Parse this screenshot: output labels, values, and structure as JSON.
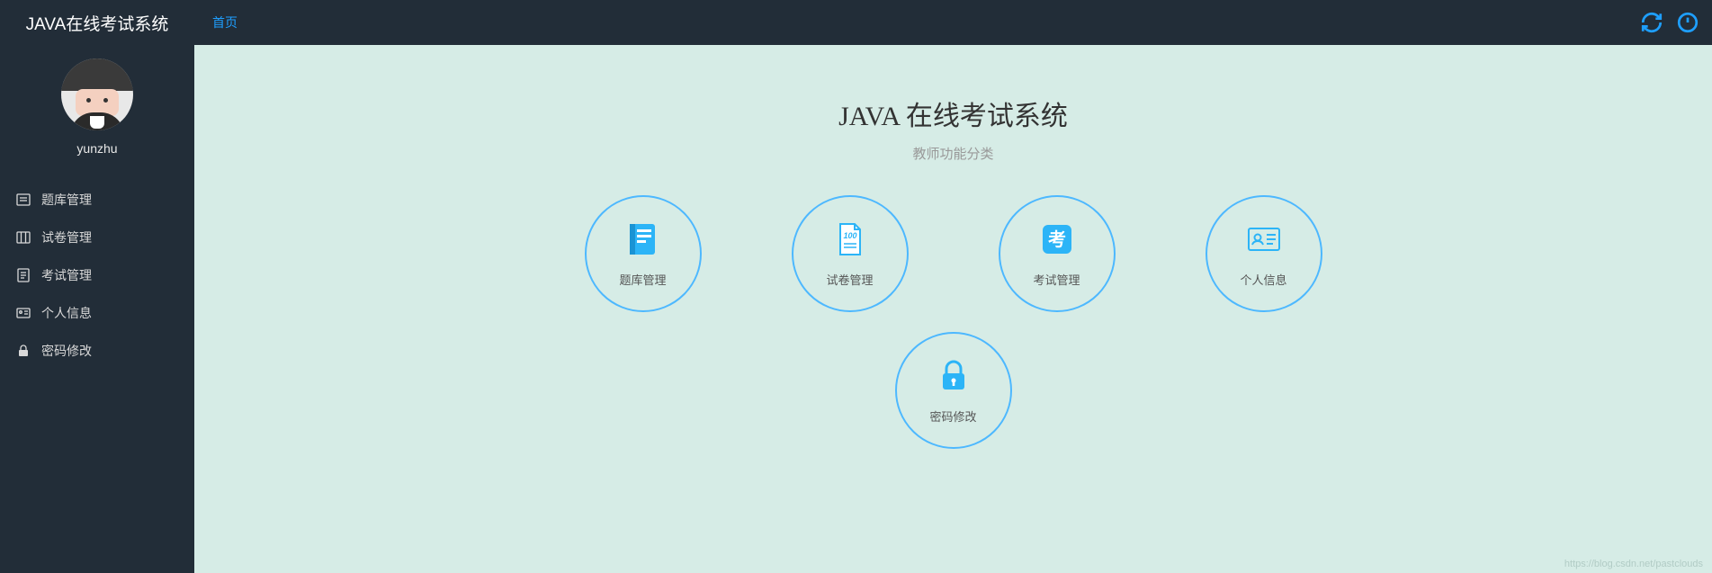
{
  "header": {
    "title": "JAVA在线考试系统",
    "home_label": "首页"
  },
  "user": {
    "name": "yunzhu"
  },
  "sidebar": {
    "items": [
      {
        "label": "题库管理"
      },
      {
        "label": "试卷管理"
      },
      {
        "label": "考试管理"
      },
      {
        "label": "个人信息"
      },
      {
        "label": "密码修改"
      }
    ]
  },
  "main": {
    "title": "JAVA 在线考试系统",
    "subtitle": "教师功能分类",
    "cards": [
      {
        "label": "题库管理"
      },
      {
        "label": "试卷管理"
      },
      {
        "label": "考试管理"
      },
      {
        "label": "个人信息"
      },
      {
        "label": "密码修改"
      }
    ]
  },
  "watermark": "https://blog.csdn.net/pastclouds",
  "colors": {
    "accent": "#1e9fff",
    "circleBorder": "#4db8ff",
    "sidebarBg": "#222d38",
    "mainBg": "#d6ece6"
  }
}
